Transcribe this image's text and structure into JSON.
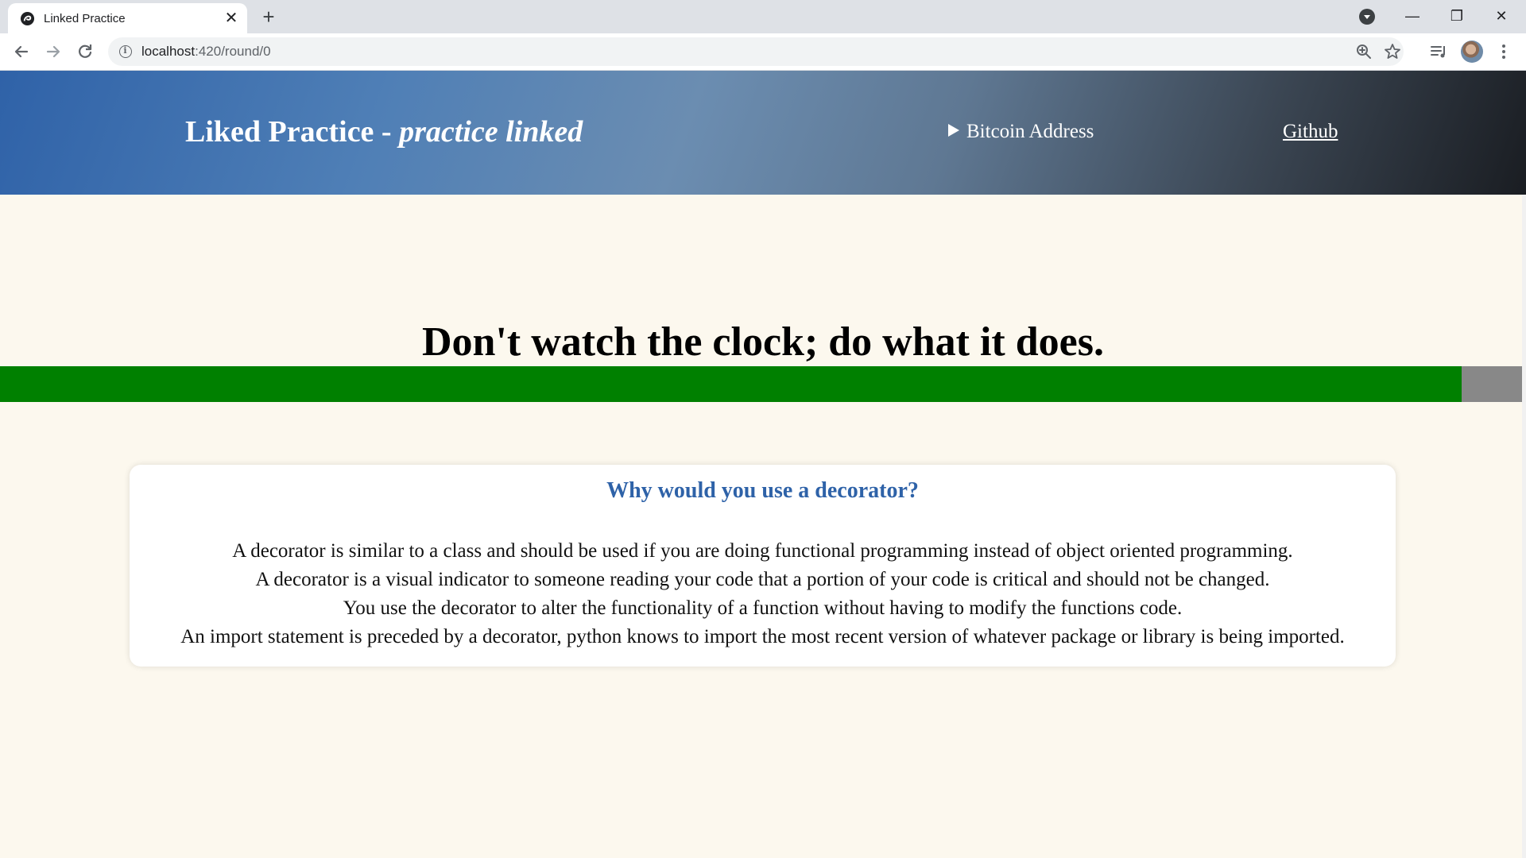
{
  "browser": {
    "tab_title": "Linked Practice",
    "new_tab_glyph": "+",
    "close_glyph": "✕",
    "url_host": "localhost",
    "url_path": ":420/round/0",
    "window_controls": {
      "minimize": "—",
      "maximize": "❐",
      "close": "✕"
    },
    "icons": [
      "favicon-icon",
      "close-icon",
      "plus-icon",
      "tab-search-icon",
      "back-icon",
      "forward-icon",
      "reload-icon",
      "info-icon",
      "zoom-icon",
      "star-icon",
      "media-icon",
      "avatar",
      "menu-icon"
    ]
  },
  "site": {
    "title": "Liked Practice - ",
    "tagline": "practice linked",
    "bitcoin_label": "Bitcoin Address",
    "github_label": "Github",
    "header_colors": {
      "start": "#2f62a8",
      "end": "#1a1d22"
    }
  },
  "quote": "Don't watch the clock; do what it does.",
  "timer": {
    "progress": 0.958,
    "fill_color": "#008000",
    "track_color": "#888888"
  },
  "question": {
    "text": "Why would you use a decorator?",
    "color": "#2e62a8",
    "answers": [
      "A decorator is similar to a class and should be used if you are doing functional programming instead of object oriented programming.",
      "A decorator is a visual indicator to someone reading your code that a portion of your code is critical and should not be changed.",
      "You use the decorator to alter the functionality of a function without having to modify the functions code.",
      "An import statement is preceded by a decorator, python knows to import the most recent version of whatever package or library is being imported."
    ]
  }
}
